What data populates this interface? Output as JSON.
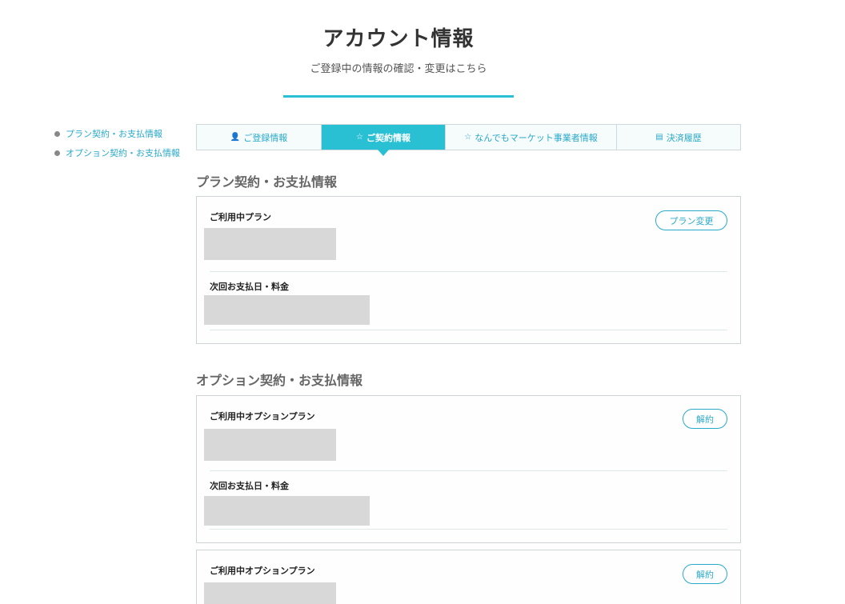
{
  "header": {
    "title": "アカウント情報",
    "subtitle": "ご登録中の情報の確認・変更はこちら"
  },
  "side_nav": {
    "items": [
      {
        "label": "プラン契約・お支払情報"
      },
      {
        "label": "オプション契約・お支払情報"
      }
    ]
  },
  "tabs": [
    {
      "label": "ご登録情報",
      "icon": "user-icon",
      "glyph": "👤",
      "active": false
    },
    {
      "label": "ご契約情報",
      "icon": "star-outline-icon",
      "glyph": "☆",
      "active": true
    },
    {
      "label": "なんでもマーケット事業者情報",
      "icon": "star-outline-icon",
      "glyph": "☆",
      "active": false
    },
    {
      "label": "決済履歴",
      "icon": "card-icon",
      "glyph": "▤",
      "active": false
    }
  ],
  "plan_section": {
    "heading": "プラン契約・お支払情報",
    "current_plan_label": "ご利用中プラン",
    "change_button": "プラン変更",
    "next_payment_label": "次回お支払日・料金"
  },
  "option_section": {
    "heading": "オプション契約・お支払情報",
    "cards": [
      {
        "current_label": "ご利用中オプションプラン",
        "cancel_button": "解約",
        "next_payment_label": "次回お支払日・料金"
      },
      {
        "current_label": "ご利用中オプションプラン",
        "cancel_button": "解約"
      }
    ]
  },
  "colors": {
    "accent": "#29c0d4",
    "link": "#29a9c9",
    "placeholder": "#d8d8d8"
  }
}
